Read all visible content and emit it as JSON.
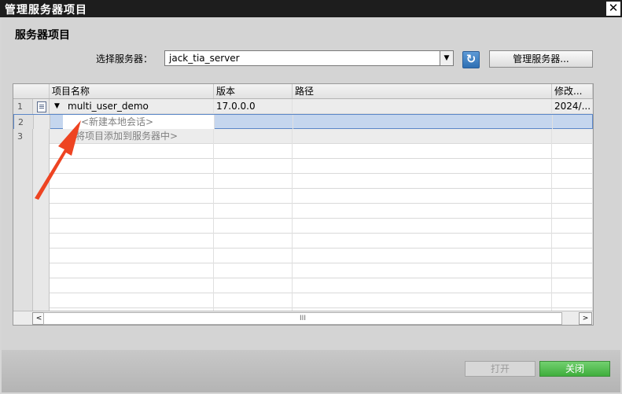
{
  "window": {
    "title": "管理服务器项目",
    "close_glyph": "✕"
  },
  "section_title": "服务器项目",
  "server": {
    "label": "选择服务器：",
    "selected": "jack_tia_server",
    "manage_label": "管理服务器..."
  },
  "table": {
    "columns": [
      "项目名称",
      "版本",
      "路径",
      "修改..."
    ],
    "rows": [
      {
        "num": "1",
        "name": "multi_user_demo",
        "version": "17.0.0.0",
        "path": "",
        "modified": "2024/..."
      },
      {
        "num": "2",
        "name": "<新建本地会话>",
        "version": "",
        "path": "",
        "modified": ""
      },
      {
        "num": "3",
        "name": "<将项目添加到服务器中>",
        "version": "",
        "path": "",
        "modified": ""
      }
    ],
    "empty_rows": 12,
    "scroll_thumb_glyph": "III",
    "scroll_left_glyph": "<",
    "scroll_right_glyph": ">"
  },
  "buttons": {
    "open": "打开",
    "close": "关闭"
  },
  "icons": {
    "refresh": "refresh-icon",
    "document": "project-document-icon",
    "expand": "expand-triangle-icon",
    "dropdown": "chevron-down-icon"
  },
  "colors": {
    "title_bar": "#1d1d1d",
    "selection": "#c5d6ee",
    "close_button": "#4fbd4c",
    "annotation_arrow": "#ee4422"
  }
}
